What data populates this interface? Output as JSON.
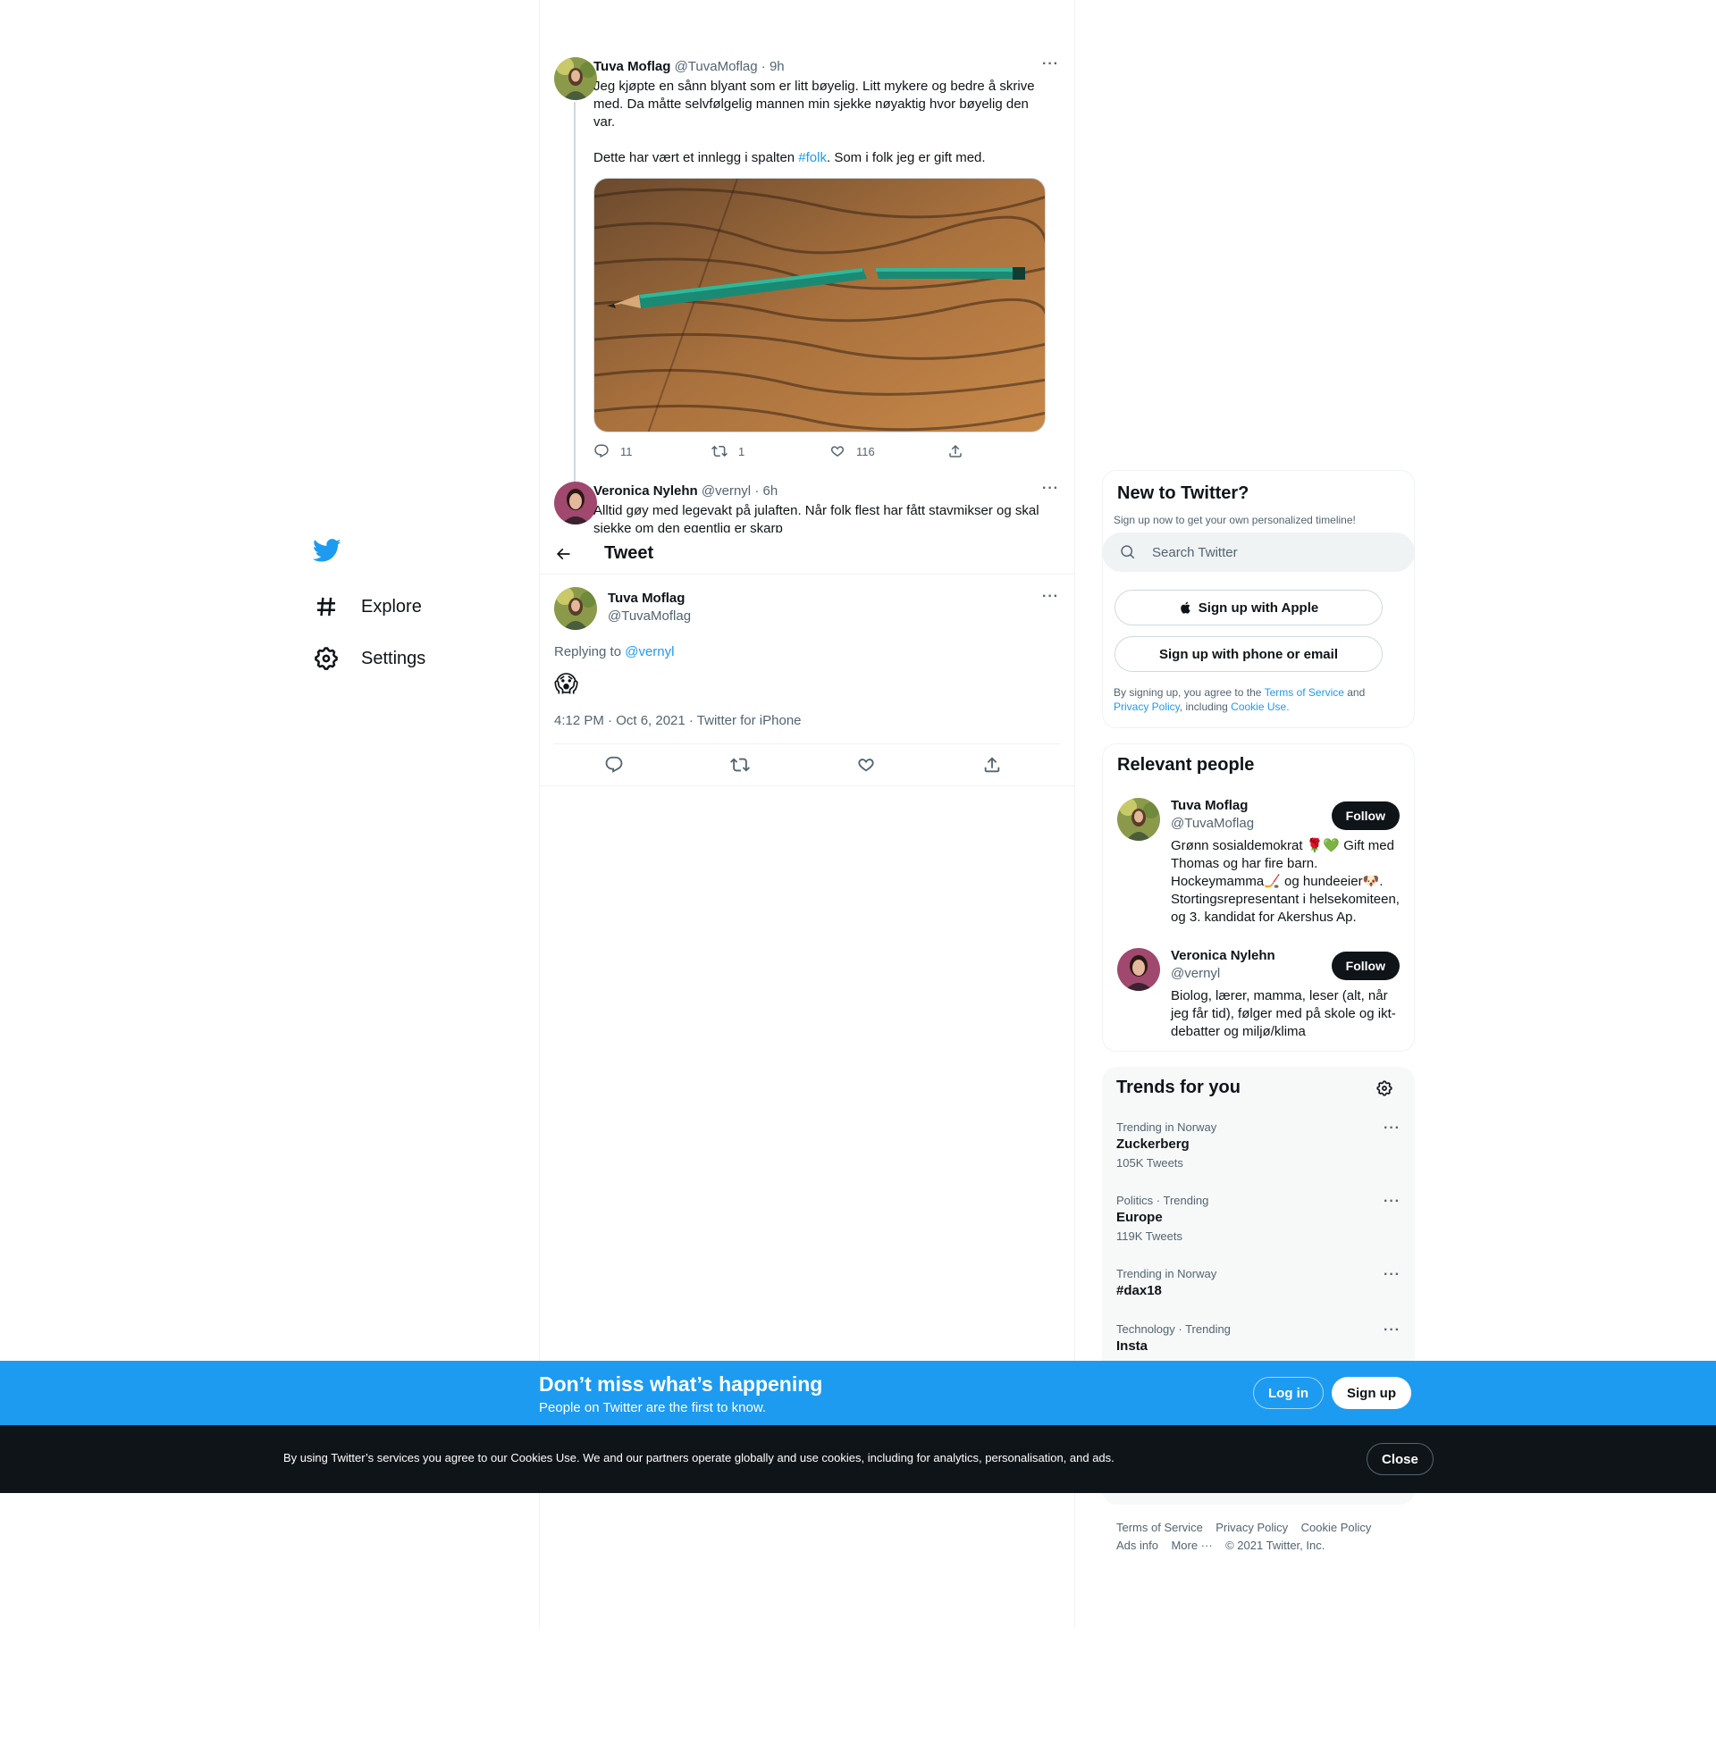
{
  "nav": {
    "explore_label": "Explore",
    "settings_label": "Settings"
  },
  "parent_tweet": {
    "author_name": "Tuva Moflag",
    "author_handle": "@TuvaMoflag",
    "time": "· 9h",
    "text_p1": "Jeg kjøpte en sånn blyant som er litt bøyelig. Litt mykere og bedre å skrive med. Da måtte selvfølgelig mannen min sjekke nøyaktig hvor bøyelig den var.",
    "text_p2_before": "Dette har vært et innlegg i spalten ",
    "text_p2_hashtag": "#folk",
    "text_p2_after": ". Som i folk jeg er gift med.",
    "reply_count": "11",
    "retweet_count": "1",
    "like_count": "116",
    "more": "···"
  },
  "reply_tweet": {
    "author_name": "Veronica Nylehn",
    "author_handle": "@vernyl",
    "time": "· 6h",
    "text": "Alltid gøy med legevakt på julaften. Når folk flest har fått stavmikser og skal sjekke om den egentlig er skarp",
    "more": "···"
  },
  "header": {
    "title": "Tweet"
  },
  "main_tweet": {
    "author_name": "Tuva Moflag",
    "author_handle": "@TuvaMoflag",
    "replying_prefix": "Replying to ",
    "replying_handle": "@vernyl",
    "text": "😱",
    "timestamp": "4:12 PM · Oct 6, 2021 · Twitter for iPhone",
    "more": "···"
  },
  "signup_card": {
    "title": "New to Twitter?",
    "subtitle": "Sign up now to get your own personalized timeline!",
    "apple_label": "Sign up with Apple",
    "phone_label": "Sign up with phone or email",
    "legal_prefix": "By signing up, you agree to the ",
    "legal_terms": "Terms of Service",
    "legal_and": " and",
    "legal_privacy": "Privacy Policy",
    "legal_including": ", including ",
    "legal_cookie": "Cookie Use."
  },
  "search": {
    "placeholder": "Search Twitter"
  },
  "relevant_people": {
    "title": "Relevant people",
    "people": [
      {
        "name": "Tuva Moflag",
        "handle": "@TuvaMoflag",
        "follow_label": "Follow",
        "bio": "Grønn sosialdemokrat 🌹💚 Gift med Thomas og har fire barn. Hockeymamma🏒 og hundeeier🐶. Stortingsrepresentant i helsekomiteen, og 3. kandidat for Akershus Ap."
      },
      {
        "name": "Veronica Nylehn",
        "handle": "@vernyl",
        "follow_label": "Follow",
        "bio": "Biolog, lærer, mamma, leser (alt, når jeg får tid), følger med på skole og ikt-debatter og miljø/klima"
      }
    ]
  },
  "trends": {
    "title": "Trends for you",
    "items": [
      {
        "context": "Trending in Norway",
        "name": "Zuckerberg",
        "count": "105K Tweets"
      },
      {
        "context": "Politics · Trending",
        "name": "Europe",
        "count": "119K Tweets"
      },
      {
        "context": "Trending in Norway",
        "name": "#dax18",
        "count": ""
      },
      {
        "context": "Technology · Trending",
        "name": "Insta",
        "count": ""
      }
    ],
    "dots": "···"
  },
  "footer": {
    "terms": "Terms of Service",
    "privacy": "Privacy Policy",
    "cookie": "Cookie Policy",
    "ads": "Ads info",
    "more": "More ···",
    "copyright": "© 2021 Twitter, Inc."
  },
  "bottom_banner": {
    "title": "Don’t miss what’s happening",
    "subtitle": "People on Twitter are the first to know.",
    "login_label": "Log in",
    "signup_label": "Sign up"
  },
  "cookie_banner": {
    "text": "By using Twitter’s services you agree to our Cookies Use. We and our partners operate globally and use cookies, including for analytics, personalisation, and ads.",
    "close_label": "Close"
  },
  "colors": {
    "accent": "#1d9bf0",
    "text": "#0f1419",
    "muted": "#536471",
    "border": "#eff3f4",
    "cookie_bg": "#0f1419"
  }
}
